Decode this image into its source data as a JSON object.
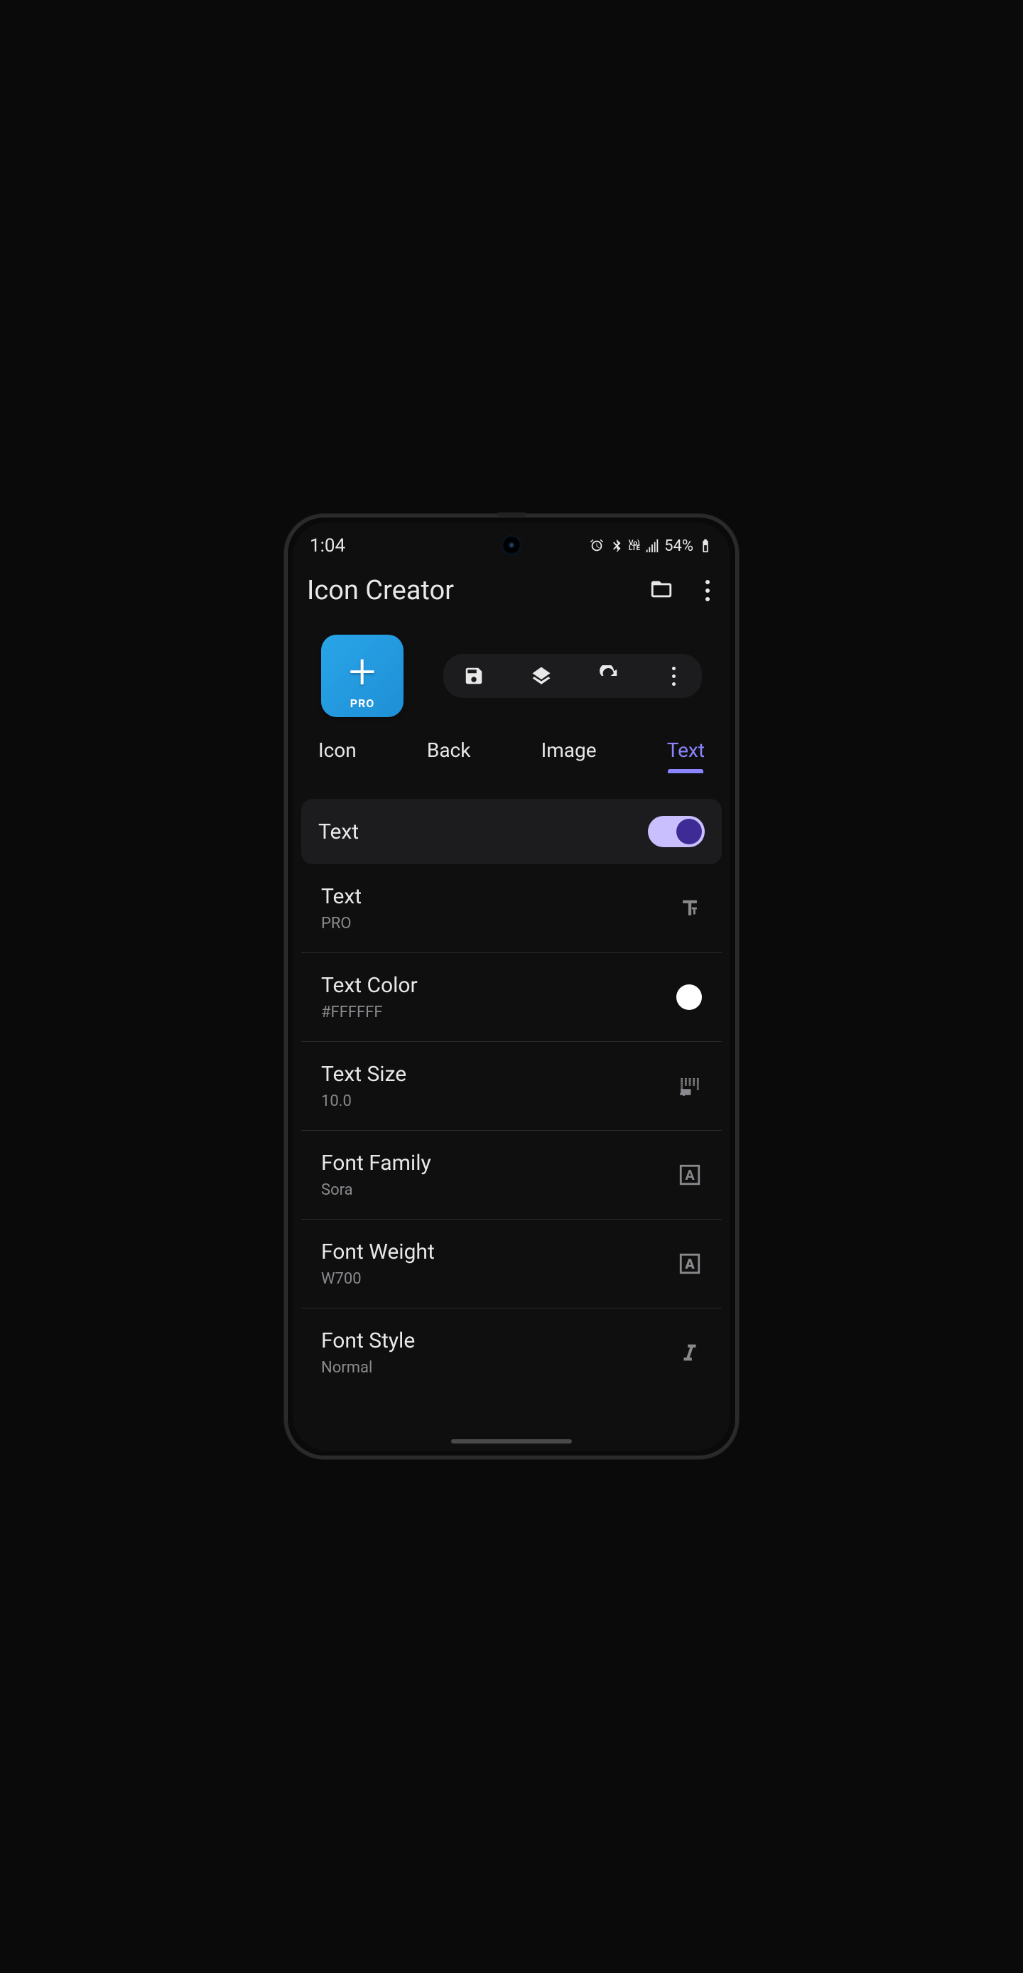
{
  "status": {
    "time": "1:04",
    "battery": "54%"
  },
  "app": {
    "title": "Icon Creator"
  },
  "preview": {
    "plusGlyph": "+",
    "label": "PRO"
  },
  "tabs": {
    "icon": "Icon",
    "back": "Back",
    "image": "Image",
    "text": "Text"
  },
  "section": {
    "title": "Text",
    "enabled": true
  },
  "settings": {
    "text": {
      "label": "Text",
      "value": "PRO"
    },
    "textColor": {
      "label": "Text Color",
      "value": "#FFFFFF"
    },
    "textSize": {
      "label": "Text Size",
      "value": "10.0"
    },
    "fontFamily": {
      "label": "Font Family",
      "value": "Sora"
    },
    "fontWeight": {
      "label": "Font Weight",
      "value": "W700"
    },
    "fontStyle": {
      "label": "Font Style",
      "value": "Normal"
    }
  }
}
